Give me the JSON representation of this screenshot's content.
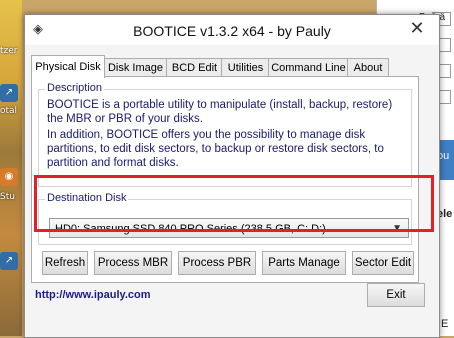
{
  "window": {
    "title": "BOOTICE v1.3.2 x64 - by Pauly",
    "close_glyph": "✕"
  },
  "tabs": [
    {
      "label": "Physical Disk",
      "active": true
    },
    {
      "label": "Disk Image",
      "active": false
    },
    {
      "label": "BCD Edit",
      "active": false
    },
    {
      "label": "Utilities",
      "active": false
    },
    {
      "label": "Command Line",
      "active": false
    },
    {
      "label": "About",
      "active": false
    }
  ],
  "description": {
    "legend": "Description",
    "paragraph1": "BOOTICE is a portable utility to manipulate (install, backup, restore) the MBR or PBR of your disks.",
    "paragraph2": "In addition, BOOTICE offers you the possibility to manage disk partitions, to edit disk sectors, to backup or restore disk sectors, to partition and format disks."
  },
  "destination": {
    "legend": "Destination Disk",
    "selected_disk": "HD0: Samsung SSD 840 PRO Series (238.5 GB, C: D:)"
  },
  "actions": {
    "refresh": "Refresh",
    "process_mbr": "Process MBR",
    "process_pbr": "Process PBR",
    "parts_manage": "Parts Manage",
    "sector_edit": "Sector Edit"
  },
  "footer": {
    "url": "http://www.ipauly.com",
    "exit": "Exit"
  },
  "background": {
    "right_window_top_text": "Beiträ",
    "desktop_labels": [
      "tzer",
      "otal",
      "Stu"
    ],
    "right_partial_texts": [
      "ou",
      "ele",
      "E"
    ]
  },
  "colors": {
    "highlight_box": "#e0212b",
    "description_text": "#1b1b6e",
    "link": "#1c1c8c"
  },
  "icons": {
    "app_icon": "diamond-icon",
    "close_icon": "close-icon",
    "dropdown_arrow": "chevron-down-icon"
  }
}
